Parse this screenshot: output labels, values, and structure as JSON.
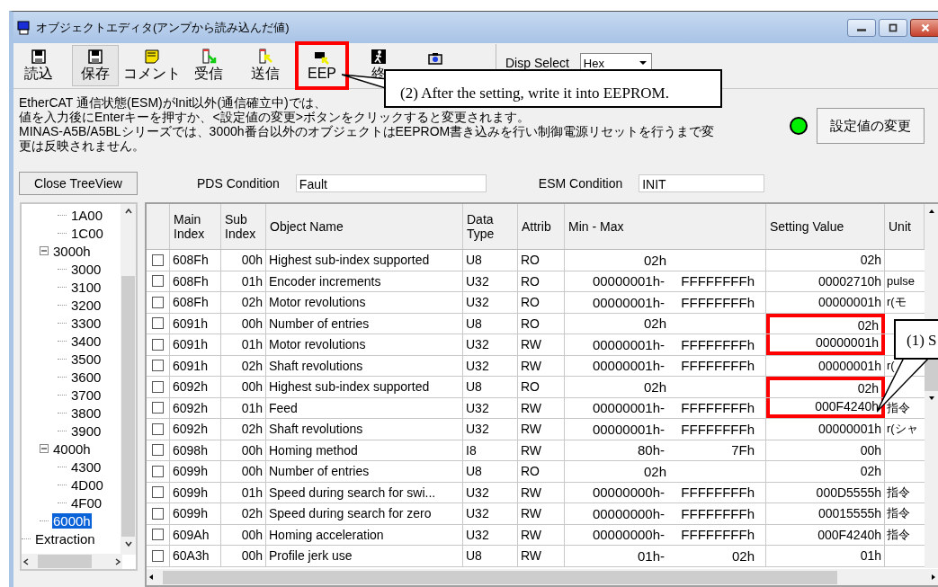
{
  "window": {
    "title": "オブジェクトエディタ(アンプから読み込んだ値)"
  },
  "toolbar": {
    "buttons": [
      {
        "label": "読込",
        "kind": "floppy",
        "pressed": false,
        "marked": false
      },
      {
        "label": "保存",
        "kind": "floppy",
        "pressed": true,
        "marked": false
      },
      {
        "label": "コメント",
        "kind": "note",
        "pressed": false,
        "marked": false
      },
      {
        "label": "受信",
        "kind": "receive",
        "pressed": false,
        "marked": false
      },
      {
        "label": "送信",
        "kind": "send",
        "pressed": false,
        "marked": false
      },
      {
        "label": "EEP",
        "kind": "eeprom",
        "pressed": false,
        "marked": true
      },
      {
        "label": "終",
        "kind": "exit",
        "pressed": false,
        "marked": false
      },
      {
        "kind": "camera",
        "pressed": false,
        "marked": false
      }
    ],
    "disp_select": {
      "label": "Disp Select",
      "value": "Hex"
    }
  },
  "message": {
    "lines": [
      "EtherCAT 通信状態(ESM)がInit以外(通信確立中)では、",
      "値を入力後にEnterキーを押すか、<設定値の変更>ボタンをクリックすると変更されます。",
      "MINAS-A5B/A5BLシリーズでは、3000h番台以外のオブジェクトはEEPROM書き込みを行い制御電源リセットを行うまで変",
      "更は反映されません。"
    ]
  },
  "status_led": {
    "on": true
  },
  "apply_button": "設定値の変更",
  "tree_toggle_button": "Close TreeView",
  "conditions": [
    {
      "label": "PDS Condition",
      "value": "Fault"
    },
    {
      "label": "ESM Condition",
      "value": "INIT"
    }
  ],
  "tree": {
    "nodes": [
      {
        "children": [
          {
            "children": [
              {
                "label": "1A00",
                "selected": false
              },
              {
                "label": "1C00",
                "selected": false
              }
            ]
          },
          {
            "label": "3000h",
            "selected": false,
            "expanded": true,
            "children": [
              {
                "label": "3000",
                "selected": false
              },
              {
                "label": "3100",
                "selected": false
              },
              {
                "label": "3200",
                "selected": false
              },
              {
                "label": "3300",
                "selected": false
              },
              {
                "label": "3400",
                "selected": false
              },
              {
                "label": "3500",
                "selected": false
              },
              {
                "label": "3600",
                "selected": false
              },
              {
                "label": "3700",
                "selected": false
              },
              {
                "label": "3800",
                "selected": false
              },
              {
                "label": "3900",
                "selected": false
              }
            ]
          },
          {
            "label": "4000h",
            "selected": false,
            "expanded": true,
            "children": [
              {
                "label": "4300",
                "selected": false
              },
              {
                "label": "4D00",
                "selected": false
              },
              {
                "label": "4F00",
                "selected": false
              }
            ]
          },
          {
            "label": "6000h",
            "selected": true
          }
        ]
      },
      {
        "label": "Extraction",
        "selected": false
      }
    ]
  },
  "table": {
    "columns": [
      "Main\nIndex",
      "Sub\nIndex",
      "Object Name",
      "Data\nType",
      "Attrib",
      "Min - Max",
      "Setting Value",
      "Unit"
    ],
    "rows": [
      {
        "checked": false,
        "main": "608Fh",
        "sub": "00h",
        "name": "Highest sub-index supported",
        "type": "U8",
        "attrib": "RO",
        "range": [
          "02h"
        ],
        "value": "02h",
        "marked": false
      },
      {
        "checked": false,
        "main": "608Fh",
        "sub": "01h",
        "name": "Encoder increments",
        "type": "U32",
        "attrib": "RO",
        "range": [
          "00000001h-",
          "FFFFFFFFh"
        ],
        "value": "00002710h",
        "unit": "pulse",
        "marked": false
      },
      {
        "checked": false,
        "main": "608Fh",
        "sub": "02h",
        "name": "Motor revolutions",
        "type": "U32",
        "attrib": "RO",
        "range": [
          "00000001h-",
          "FFFFFFFFh"
        ],
        "value": "00000001h",
        "unit": "r(モ",
        "marked": false
      },
      {
        "checked": false,
        "main": "6091h",
        "sub": "00h",
        "name": "Number of entries",
        "type": "U8",
        "attrib": "RO",
        "range": [
          "02h"
        ],
        "value": "02h",
        "marked": true
      },
      {
        "checked": false,
        "main": "6091h",
        "sub": "01h",
        "name": "Motor revolutions",
        "type": "U32",
        "attrib": "RW",
        "range": [
          "00000001h-",
          "FFFFFFFFh"
        ],
        "value": "00000001h",
        "marked": true
      },
      {
        "checked": false,
        "main": "6091h",
        "sub": "02h",
        "name": "Shaft revolutions",
        "type": "U32",
        "attrib": "RW",
        "range": [
          "00000001h-",
          "FFFFFFFFh"
        ],
        "value": "00000001h",
        "unit": "r(",
        "marked": false
      },
      {
        "checked": false,
        "main": "6092h",
        "sub": "00h",
        "name": "Highest sub-index supported",
        "type": "U8",
        "attrib": "RO",
        "range": [
          "02h"
        ],
        "value": "02h",
        "marked": true
      },
      {
        "checked": false,
        "main": "6092h",
        "sub": "01h",
        "name": "Feed",
        "type": "U32",
        "attrib": "RW",
        "range": [
          "00000001h-",
          "FFFFFFFFh"
        ],
        "value": "000F4240h",
        "unit": "指令",
        "marked": true
      },
      {
        "checked": false,
        "main": "6092h",
        "sub": "02h",
        "name": "Shaft revolutions",
        "type": "U32",
        "attrib": "RW",
        "range": [
          "00000001h-",
          "FFFFFFFFh"
        ],
        "value": "00000001h",
        "unit": "r(シャ",
        "marked": false
      },
      {
        "checked": false,
        "main": "6098h",
        "sub": "00h",
        "name": "Homing method",
        "type": "I8",
        "attrib": "RW",
        "range": [
          "80h-",
          "7Fh"
        ],
        "value": "00h",
        "marked": false
      },
      {
        "checked": false,
        "main": "6099h",
        "sub": "00h",
        "name": "Number of entries",
        "type": "U8",
        "attrib": "RO",
        "range": [
          "02h"
        ],
        "value": "02h",
        "marked": false
      },
      {
        "checked": false,
        "main": "6099h",
        "sub": "01h",
        "name": "Speed during search for swi...",
        "type": "U32",
        "attrib": "RW",
        "range": [
          "00000000h-",
          "FFFFFFFFh"
        ],
        "value": "000D5555h",
        "unit": "指令",
        "marked": false
      },
      {
        "checked": false,
        "main": "6099h",
        "sub": "02h",
        "name": "Speed during search for zero",
        "type": "U32",
        "attrib": "RW",
        "range": [
          "00000000h-",
          "FFFFFFFFh"
        ],
        "value": "00015555h",
        "unit": "指令",
        "marked": false
      },
      {
        "checked": false,
        "main": "609Ah",
        "sub": "00h",
        "name": "Homing acceleration",
        "type": "U32",
        "attrib": "RW",
        "range": [
          "00000000h-",
          "FFFFFFFFh"
        ],
        "value": "000F4240h",
        "unit": "指令",
        "marked": false
      },
      {
        "checked": false,
        "main": "60A3h",
        "sub": "00h",
        "name": "Profile jerk use",
        "type": "U8",
        "attrib": "RW",
        "range": [
          "01h-",
          "02h"
        ],
        "value": "01h",
        "marked": false
      }
    ]
  },
  "callouts": [
    {
      "text": "(2) After the setting, write it into EEPROM."
    },
    {
      "text": "(1) S"
    }
  ]
}
